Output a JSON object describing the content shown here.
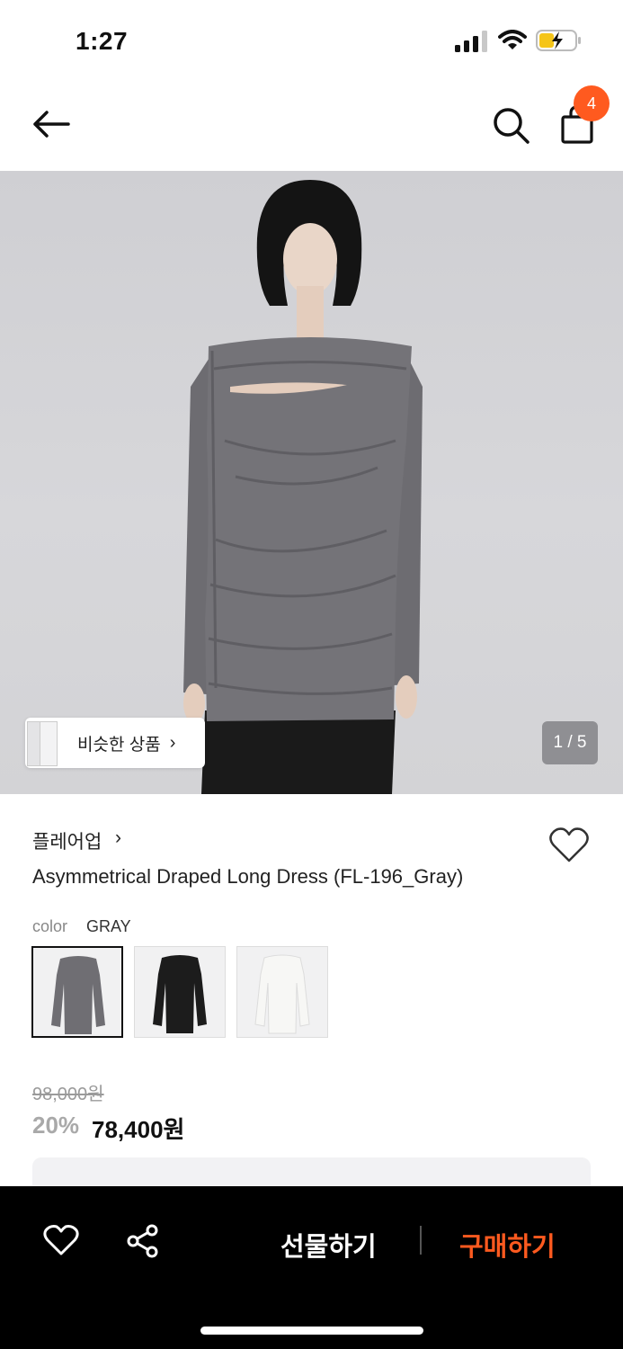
{
  "status": {
    "time": "1:27"
  },
  "nav": {
    "cart_count": "4",
    "icons": [
      "back-arrow-icon",
      "search-icon",
      "shopping-bag-icon"
    ]
  },
  "gallery": {
    "similar_label": "비슷한 상품",
    "similar_chevron": "›",
    "counter": "1 / 5"
  },
  "product": {
    "brand": "플레어업",
    "brand_chevron": "›",
    "name": "Asymmetrical Draped Long Dress (FL-196_Gray)",
    "color_label": "color",
    "color_value": "GRAY",
    "swatches": [
      "gray",
      "black",
      "white"
    ],
    "original_price": "98,000원",
    "discount": "20%",
    "price": "78,400원"
  },
  "bottom_bar": {
    "gift_label": "선물하기",
    "buy_label": "구매하기"
  },
  "colors": {
    "accent": "#ff5a1f",
    "bar": "#000000"
  }
}
